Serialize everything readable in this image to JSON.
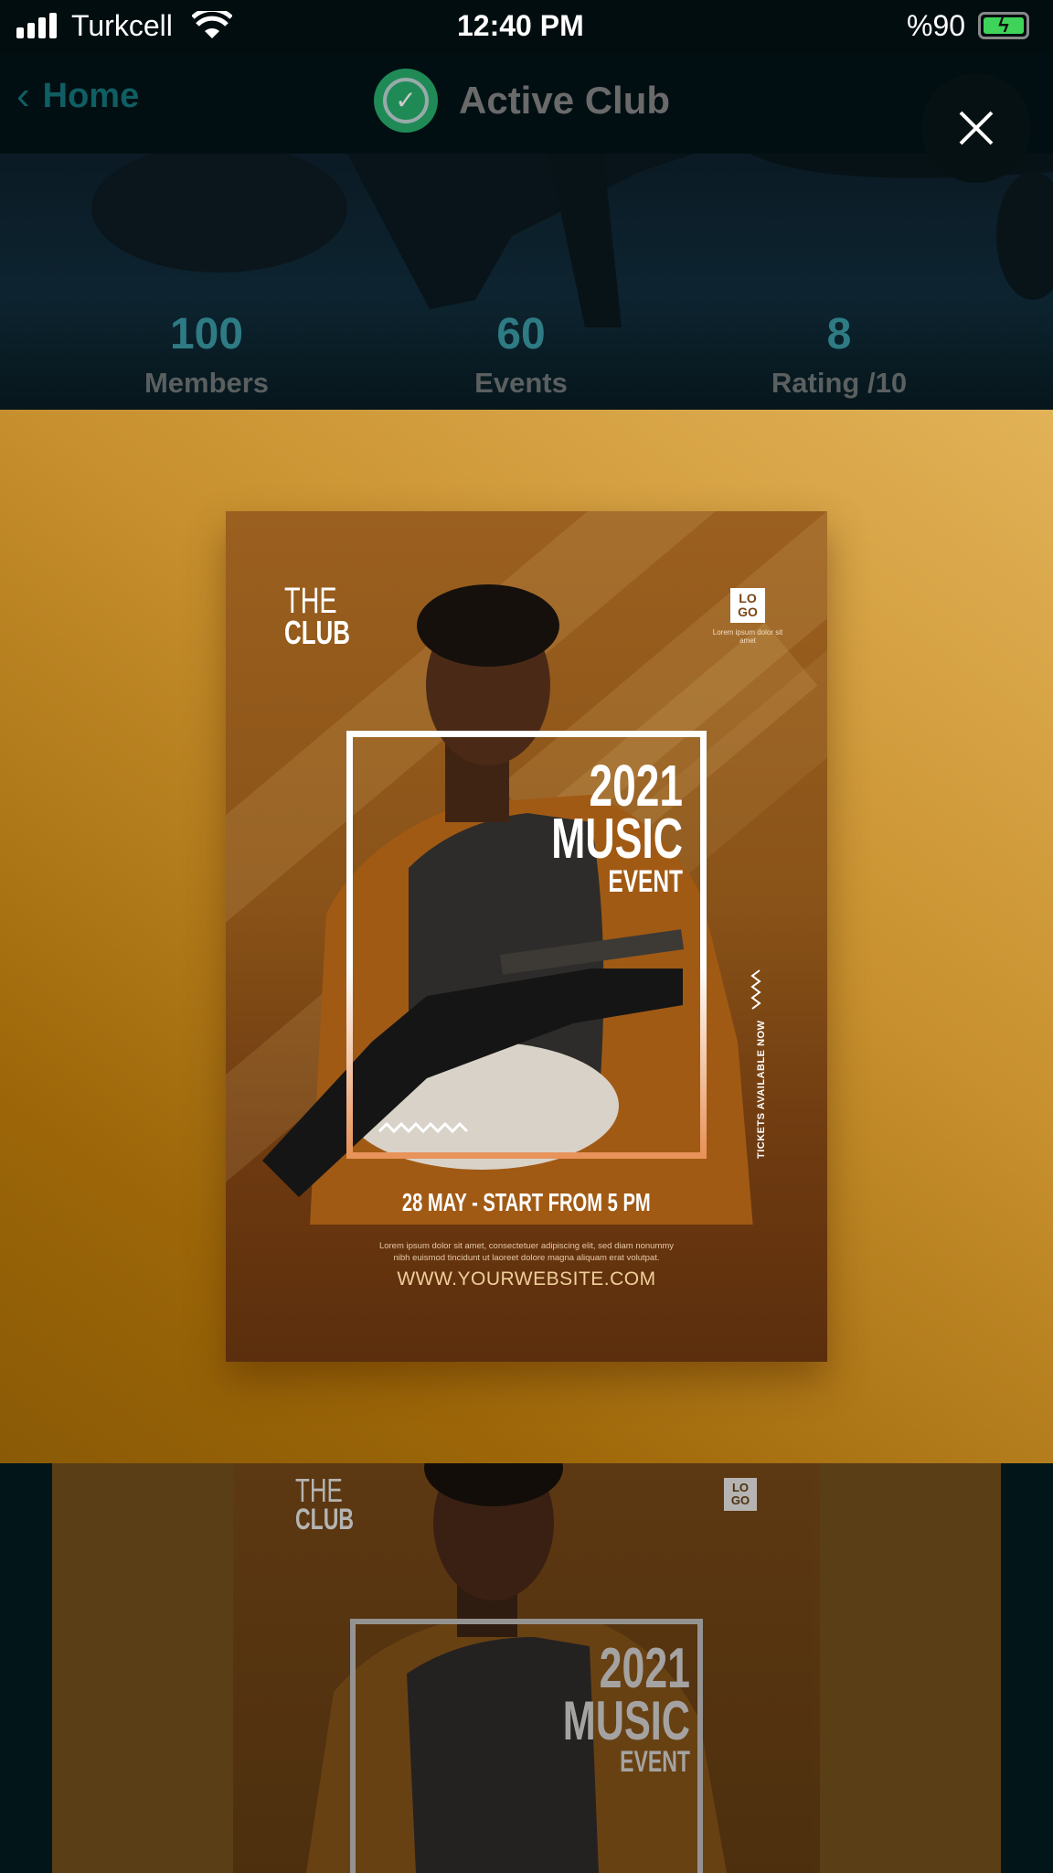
{
  "status_bar": {
    "carrier": "Turkcell",
    "time": "12:40 PM",
    "battery": "%90"
  },
  "nav": {
    "back_label": "Home",
    "title": "Active Club"
  },
  "stats": [
    {
      "value": "100",
      "label": "Members"
    },
    {
      "value": "60",
      "label": "Events"
    },
    {
      "value": "8",
      "label": "Rating /10"
    }
  ],
  "poster": {
    "brand_line1": "THE",
    "brand_line2": "CLUB",
    "logo_line1": "LO",
    "logo_line2": "GO",
    "logo_caption": "Lorem ipsum dolor sit amet",
    "year": "2021",
    "headline": "MUSIC",
    "subheadline": "EVENT",
    "side_text": "TICKETS AVAILABLE NOW",
    "date": "28 MAY - START FROM 5 PM",
    "body_line1": "Lorem ipsum dolor sit amet, consectetuer adipiscing elit, sed diam nonummy",
    "body_line2": "nibh euismod tincidunt ut laoreet dolore magna aliquam erat volutpat.",
    "website": "WWW.YOURWEBSITE.COM"
  },
  "colors": {
    "accent": "#2e7b84",
    "check_green": "#1f8a55",
    "poster_frame": "#e8935a"
  }
}
